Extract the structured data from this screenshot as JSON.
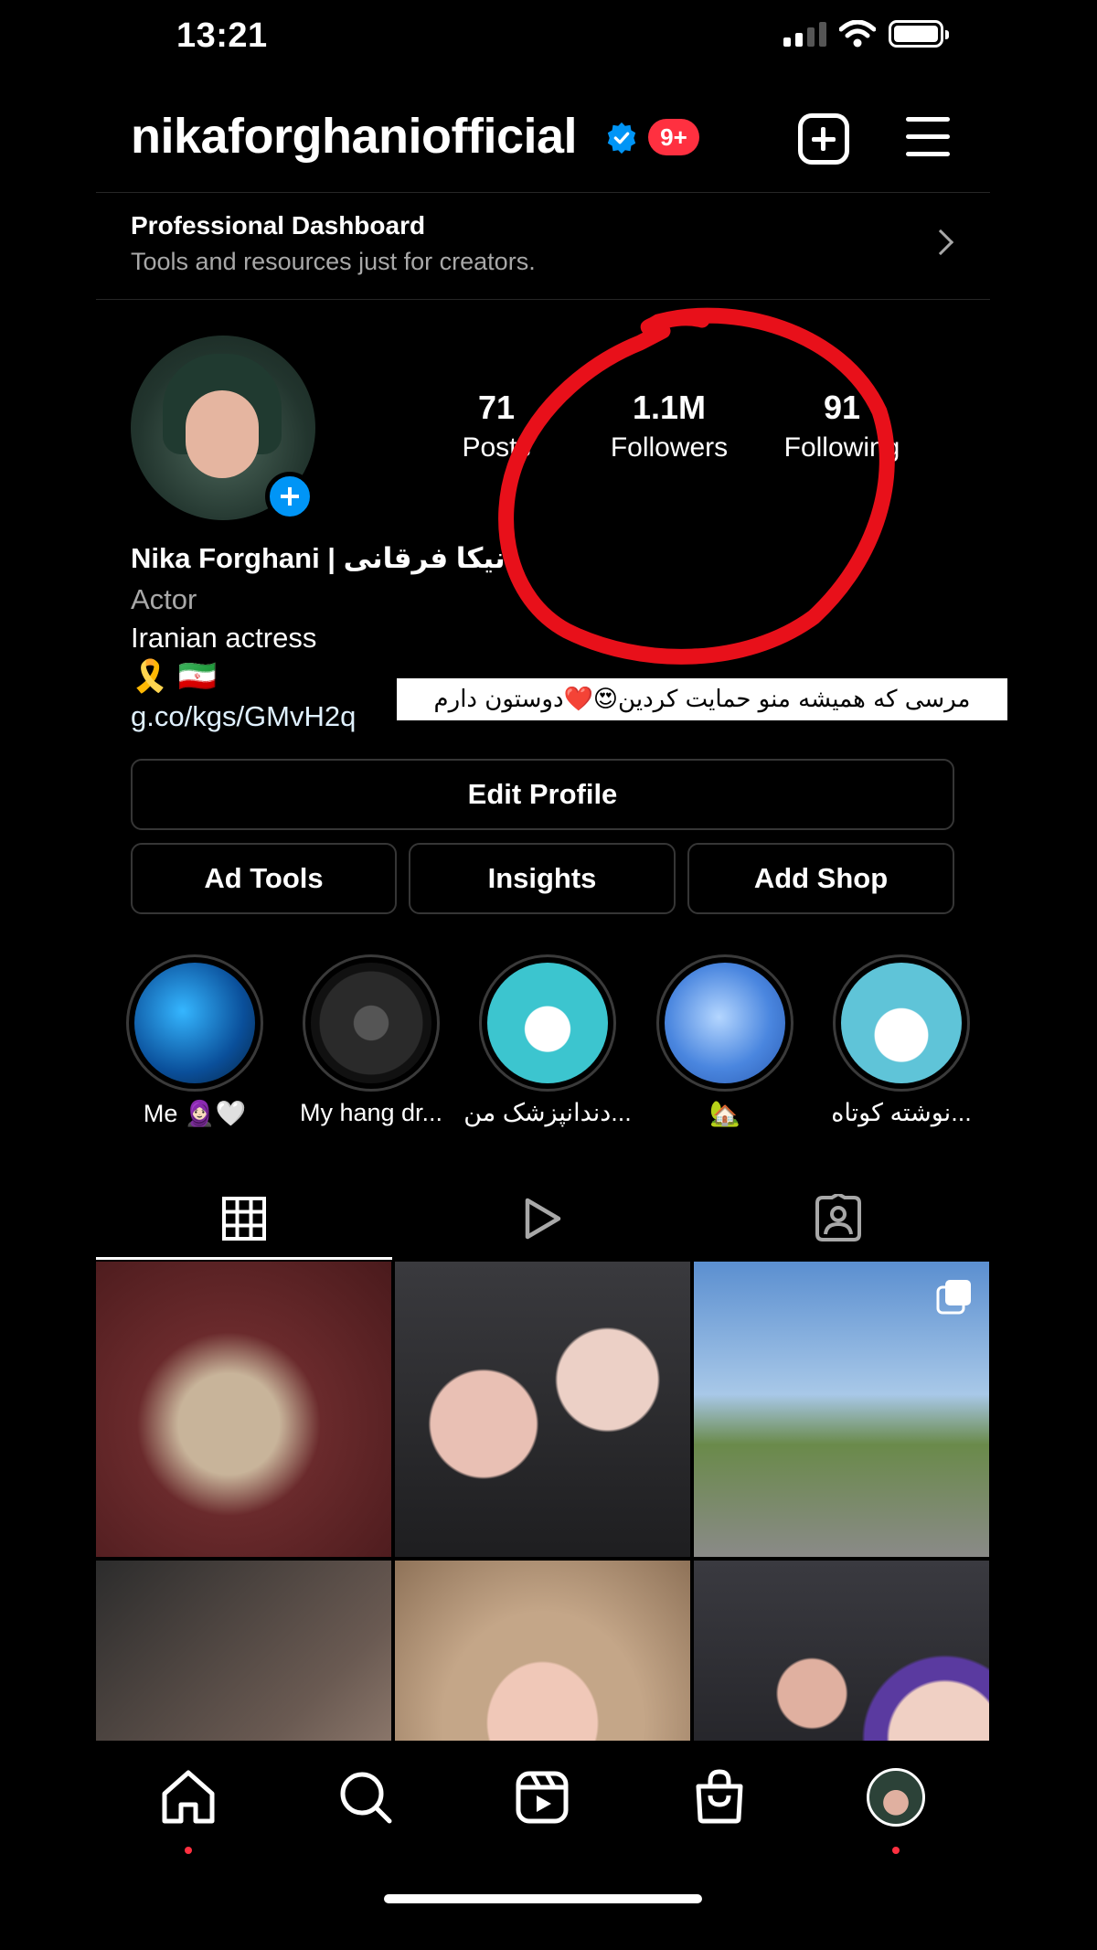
{
  "status_bar": {
    "time": "13:21"
  },
  "header": {
    "username": "nikaforghaniofficial",
    "notification_count": "9+"
  },
  "dashboard": {
    "title": "Professional Dashboard",
    "subtitle": "Tools and resources just for creators."
  },
  "stats": [
    {
      "value": "71",
      "label": "Posts"
    },
    {
      "value": "1.1M",
      "label": "Followers"
    },
    {
      "value": "91",
      "label": "Following"
    }
  ],
  "profile": {
    "full_name": "Nika Forghani | نیکا فرقانی",
    "category": "Actor",
    "bio": "Iranian actress",
    "bio_emoji": "🎗️ 🇮🇷",
    "link": "g.co/kgs/GMvH2q"
  },
  "overlay_caption": "مرسی که همیشه منو حمایت کردین😍❤️دوستون دارم",
  "buttons": {
    "edit_profile": "Edit Profile",
    "ad_tools": "Ad Tools",
    "insights": "Insights",
    "add_shop": "Add Shop"
  },
  "highlights": [
    {
      "label": "Me 🧕🏻🤍"
    },
    {
      "label": "My hang dr..."
    },
    {
      "label": "دندانپزشک من..."
    },
    {
      "label": "🏡"
    },
    {
      "label": "نوشته کوتاه..."
    }
  ],
  "colors": {
    "accent_blue": "#0095f6",
    "badge_red": "#ff3040",
    "annotation_red": "#e8101a"
  }
}
